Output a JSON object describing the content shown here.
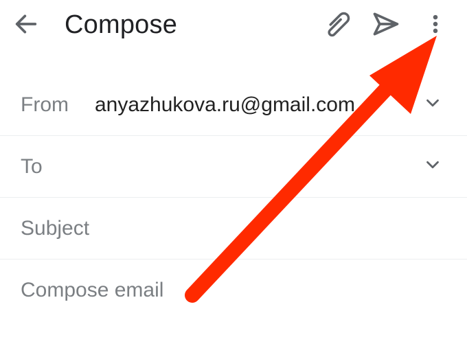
{
  "header": {
    "title": "Compose"
  },
  "from": {
    "label": "From",
    "value": "anyazhukova.ru@gmail.com"
  },
  "to": {
    "label": "To"
  },
  "subject": {
    "placeholder": "Subject"
  },
  "body": {
    "placeholder": "Compose email"
  },
  "annotation": {
    "color": "#ff2a00"
  }
}
